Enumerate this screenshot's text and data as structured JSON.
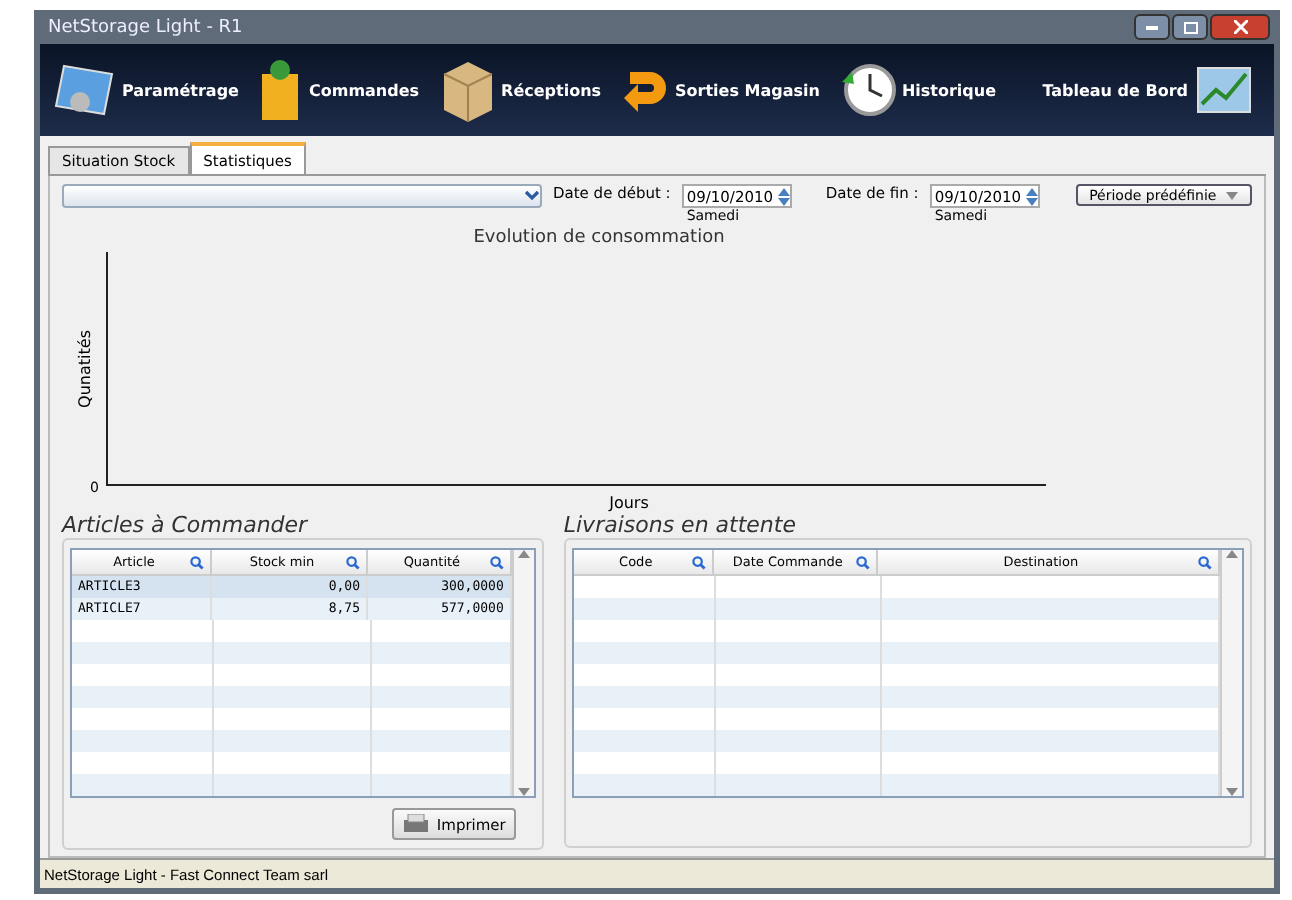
{
  "window": {
    "title": "NetStorage Light - R1"
  },
  "toolbar": {
    "items": [
      {
        "label": "Paramétrage",
        "kind": "settings"
      },
      {
        "label": "Commandes",
        "kind": "bag"
      },
      {
        "label": "Réceptions",
        "kind": "box"
      },
      {
        "label": "Sorties Magasin",
        "kind": "arrow"
      },
      {
        "label": "Historique",
        "kind": "clock"
      }
    ],
    "dashboard": {
      "label": "Tableau de Bord"
    }
  },
  "tabs": [
    {
      "label": "Situation Stock",
      "selected": false
    },
    {
      "label": "Statistiques",
      "selected": true
    }
  ],
  "filters": {
    "start_label": "Date de début :",
    "start_value": "09/10/2010",
    "start_day": "Samedi",
    "end_label": "Date de fin :",
    "end_value": "09/10/2010",
    "end_day": "Samedi",
    "period_button": "Période prédéfinie"
  },
  "chart": {
    "title": "Evolution de consommation",
    "ylabel": "Qunatités",
    "xlabel": "Jours",
    "ytick": "0"
  },
  "articles": {
    "title": "Articles à Commander",
    "columns": [
      "Article",
      "Stock min",
      "Quantité"
    ],
    "rows": [
      {
        "cells": [
          "ARTICLE3",
          "0,00",
          "300,0000"
        ],
        "selected": true
      },
      {
        "cells": [
          "ARTICLE7",
          "8,75",
          "577,0000"
        ],
        "selected": false
      }
    ],
    "print_button": "Imprimer"
  },
  "deliveries": {
    "title": "Livraisons en attente",
    "columns": [
      "Code",
      "Date Commande",
      "Destination"
    ]
  },
  "status_bar": "NetStorage Light - Fast Connect Team sarl"
}
